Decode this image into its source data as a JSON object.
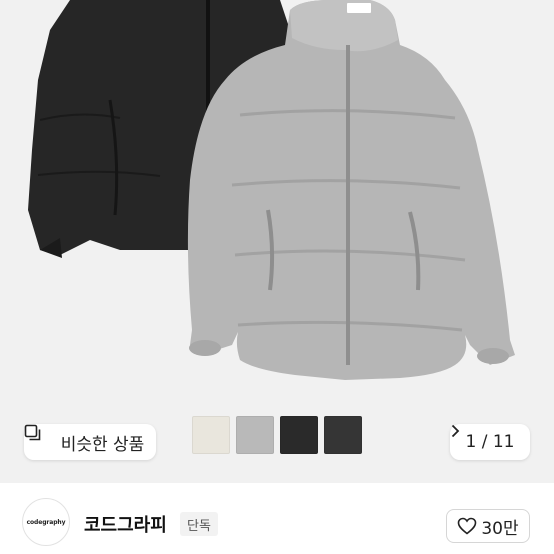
{
  "similar_button": {
    "label": "비슷한 상품",
    "icon": "similar-products-icon"
  },
  "swatches": [
    {
      "name": "ivory",
      "color": "#e9e6dd"
    },
    {
      "name": "light-gray",
      "color": "#b9b9b9"
    },
    {
      "name": "black",
      "color": "#2a2a2a"
    },
    {
      "name": "charcoal",
      "color": "#353535"
    }
  ],
  "pager": {
    "label": "1 / 11",
    "icon": "chevron-right-icon"
  },
  "brand": {
    "logo_text": "codegraphy",
    "name": "코드그라피",
    "badge": "단독"
  },
  "like": {
    "count": "30만",
    "icon": "heart-outline-icon"
  }
}
